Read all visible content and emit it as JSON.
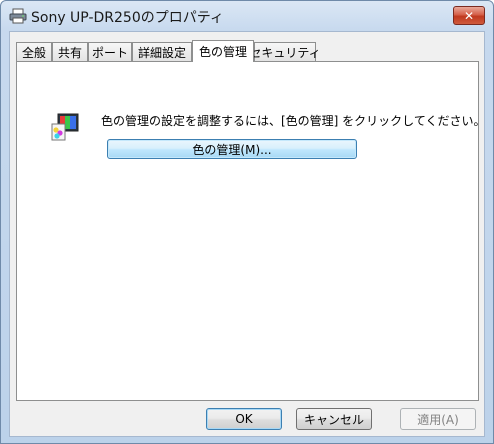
{
  "window": {
    "title": "Sony UP-DR250のプロパティ",
    "close_label": "✕"
  },
  "tabs": [
    {
      "label": "全般"
    },
    {
      "label": "共有"
    },
    {
      "label": "ポート"
    },
    {
      "label": "詳細設定"
    },
    {
      "label": "色の管理",
      "active": true
    },
    {
      "label": "セキュリティ"
    }
  ],
  "color_management": {
    "description": "色の管理の設定を調整するには、[色の管理] をクリックしてください。",
    "button_label": "色の管理(M)..."
  },
  "footer": {
    "ok_label": "OK",
    "cancel_label": "キャンセル",
    "apply_label": "適用(A)"
  },
  "colors": {
    "accent": "#3c7fb1",
    "close": "#c0391f"
  },
  "icons": {
    "title": "printer-icon",
    "panel": "color-management-icon",
    "close": "close-icon"
  }
}
